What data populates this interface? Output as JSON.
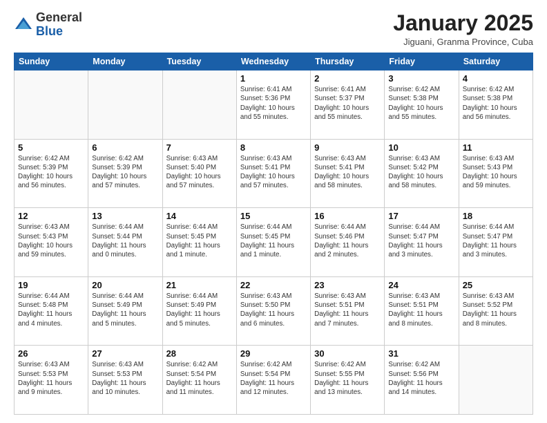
{
  "header": {
    "logo_general": "General",
    "logo_blue": "Blue",
    "month_title": "January 2025",
    "subtitle": "Jiguani, Granma Province, Cuba"
  },
  "weekdays": [
    "Sunday",
    "Monday",
    "Tuesday",
    "Wednesday",
    "Thursday",
    "Friday",
    "Saturday"
  ],
  "weeks": [
    [
      {
        "day": "",
        "info": ""
      },
      {
        "day": "",
        "info": ""
      },
      {
        "day": "",
        "info": ""
      },
      {
        "day": "1",
        "info": "Sunrise: 6:41 AM\nSunset: 5:36 PM\nDaylight: 10 hours\nand 55 minutes."
      },
      {
        "day": "2",
        "info": "Sunrise: 6:41 AM\nSunset: 5:37 PM\nDaylight: 10 hours\nand 55 minutes."
      },
      {
        "day": "3",
        "info": "Sunrise: 6:42 AM\nSunset: 5:38 PM\nDaylight: 10 hours\nand 55 minutes."
      },
      {
        "day": "4",
        "info": "Sunrise: 6:42 AM\nSunset: 5:38 PM\nDaylight: 10 hours\nand 56 minutes."
      }
    ],
    [
      {
        "day": "5",
        "info": "Sunrise: 6:42 AM\nSunset: 5:39 PM\nDaylight: 10 hours\nand 56 minutes."
      },
      {
        "day": "6",
        "info": "Sunrise: 6:42 AM\nSunset: 5:39 PM\nDaylight: 10 hours\nand 57 minutes."
      },
      {
        "day": "7",
        "info": "Sunrise: 6:43 AM\nSunset: 5:40 PM\nDaylight: 10 hours\nand 57 minutes."
      },
      {
        "day": "8",
        "info": "Sunrise: 6:43 AM\nSunset: 5:41 PM\nDaylight: 10 hours\nand 57 minutes."
      },
      {
        "day": "9",
        "info": "Sunrise: 6:43 AM\nSunset: 5:41 PM\nDaylight: 10 hours\nand 58 minutes."
      },
      {
        "day": "10",
        "info": "Sunrise: 6:43 AM\nSunset: 5:42 PM\nDaylight: 10 hours\nand 58 minutes."
      },
      {
        "day": "11",
        "info": "Sunrise: 6:43 AM\nSunset: 5:43 PM\nDaylight: 10 hours\nand 59 minutes."
      }
    ],
    [
      {
        "day": "12",
        "info": "Sunrise: 6:43 AM\nSunset: 5:43 PM\nDaylight: 10 hours\nand 59 minutes."
      },
      {
        "day": "13",
        "info": "Sunrise: 6:44 AM\nSunset: 5:44 PM\nDaylight: 11 hours\nand 0 minutes."
      },
      {
        "day": "14",
        "info": "Sunrise: 6:44 AM\nSunset: 5:45 PM\nDaylight: 11 hours\nand 1 minute."
      },
      {
        "day": "15",
        "info": "Sunrise: 6:44 AM\nSunset: 5:45 PM\nDaylight: 11 hours\nand 1 minute."
      },
      {
        "day": "16",
        "info": "Sunrise: 6:44 AM\nSunset: 5:46 PM\nDaylight: 11 hours\nand 2 minutes."
      },
      {
        "day": "17",
        "info": "Sunrise: 6:44 AM\nSunset: 5:47 PM\nDaylight: 11 hours\nand 3 minutes."
      },
      {
        "day": "18",
        "info": "Sunrise: 6:44 AM\nSunset: 5:47 PM\nDaylight: 11 hours\nand 3 minutes."
      }
    ],
    [
      {
        "day": "19",
        "info": "Sunrise: 6:44 AM\nSunset: 5:48 PM\nDaylight: 11 hours\nand 4 minutes."
      },
      {
        "day": "20",
        "info": "Sunrise: 6:44 AM\nSunset: 5:49 PM\nDaylight: 11 hours\nand 5 minutes."
      },
      {
        "day": "21",
        "info": "Sunrise: 6:44 AM\nSunset: 5:49 PM\nDaylight: 11 hours\nand 5 minutes."
      },
      {
        "day": "22",
        "info": "Sunrise: 6:43 AM\nSunset: 5:50 PM\nDaylight: 11 hours\nand 6 minutes."
      },
      {
        "day": "23",
        "info": "Sunrise: 6:43 AM\nSunset: 5:51 PM\nDaylight: 11 hours\nand 7 minutes."
      },
      {
        "day": "24",
        "info": "Sunrise: 6:43 AM\nSunset: 5:51 PM\nDaylight: 11 hours\nand 8 minutes."
      },
      {
        "day": "25",
        "info": "Sunrise: 6:43 AM\nSunset: 5:52 PM\nDaylight: 11 hours\nand 8 minutes."
      }
    ],
    [
      {
        "day": "26",
        "info": "Sunrise: 6:43 AM\nSunset: 5:53 PM\nDaylight: 11 hours\nand 9 minutes."
      },
      {
        "day": "27",
        "info": "Sunrise: 6:43 AM\nSunset: 5:53 PM\nDaylight: 11 hours\nand 10 minutes."
      },
      {
        "day": "28",
        "info": "Sunrise: 6:42 AM\nSunset: 5:54 PM\nDaylight: 11 hours\nand 11 minutes."
      },
      {
        "day": "29",
        "info": "Sunrise: 6:42 AM\nSunset: 5:54 PM\nDaylight: 11 hours\nand 12 minutes."
      },
      {
        "day": "30",
        "info": "Sunrise: 6:42 AM\nSunset: 5:55 PM\nDaylight: 11 hours\nand 13 minutes."
      },
      {
        "day": "31",
        "info": "Sunrise: 6:42 AM\nSunset: 5:56 PM\nDaylight: 11 hours\nand 14 minutes."
      },
      {
        "day": "",
        "info": ""
      }
    ]
  ]
}
